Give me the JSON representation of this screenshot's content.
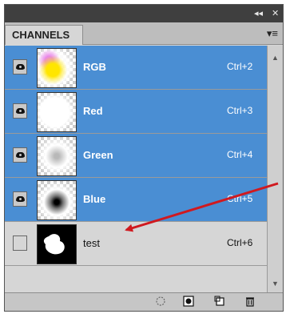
{
  "panel": {
    "tab_label": "CHANNELS",
    "collapse_label": "◂◂",
    "close_label": "✕",
    "menu_icon": "panel-menu-icon"
  },
  "channels": [
    {
      "name": "RGB",
      "shortcut": "Ctrl+2",
      "visible": true,
      "selected": true
    },
    {
      "name": "Red",
      "shortcut": "Ctrl+3",
      "visible": false,
      "selected": true
    },
    {
      "name": "Green",
      "shortcut": "Ctrl+4",
      "visible": true,
      "selected": true
    },
    {
      "name": "Blue",
      "shortcut": "Ctrl+5",
      "visible": true,
      "selected": true
    },
    {
      "name": "test",
      "shortcut": "Ctrl+6",
      "visible": false,
      "selected": false
    }
  ],
  "footer": {
    "buttons": [
      "load-selection-icon",
      "save-selection-icon",
      "new-channel-icon",
      "delete-channel-icon"
    ]
  },
  "colors": {
    "selection": "#4a8ed3",
    "panel_bg": "#d6d6d6",
    "annotation_arrow": "#d0191f"
  }
}
